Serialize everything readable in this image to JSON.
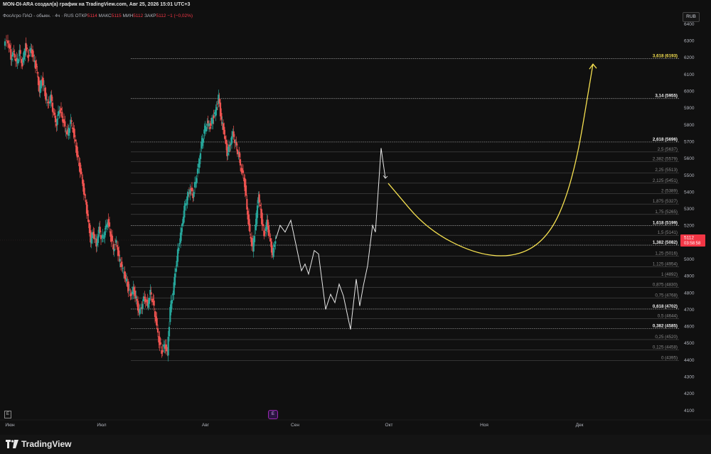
{
  "header": {
    "title": "MON-DI-ARA создал(а) график на TradingView.com, Авг 25, 2026 15:01 UTC+3"
  },
  "legend": {
    "symbol": "ФосАгро ПАО - обыкн. · 4ч · RUS",
    "open_label": "ОТКР",
    "open": "5114",
    "high_label": "МАКС",
    "high": "5115",
    "low_label": "МИН",
    "low": "5112",
    "close_label": "ЗАКР",
    "close": "5112",
    "change": "−1 (−0,02%)"
  },
  "currency": "RUB",
  "footer": {
    "brand": "TradingView",
    "e_icon": "E",
    "event_icon": "E"
  },
  "colors": {
    "background": "#101010",
    "up": "#26a69a",
    "down": "#ef5350",
    "projection": "#e8e8e8",
    "arrow": "#f5e050",
    "price_tag": "#f23645",
    "fib_line": "#8a8a8a"
  },
  "chart_data": {
    "type": "candlestick",
    "y_axis": {
      "ticks": [
        4100,
        4200,
        4300,
        4400,
        4500,
        4600,
        4700,
        4800,
        4900,
        5000,
        5100,
        5200,
        5300,
        5400,
        5500,
        5600,
        5700,
        5800,
        5900,
        6000,
        6100,
        6200,
        6300,
        6400
      ],
      "range": [
        4080,
        6440
      ],
      "position": "right"
    },
    "x_axis": {
      "labels": [
        "Июн",
        "Июл",
        "Авг",
        "Сен",
        "Окт",
        "Ноя",
        "Дек"
      ]
    },
    "price_marker": {
      "value": 5112,
      "label": "5112",
      "countdown": "03:58:58"
    },
    "fib_levels": [
      {
        "ratio": "3,618",
        "price": 6193,
        "label": "3,618 (6193)",
        "highlight": "yellow"
      },
      {
        "ratio": "3,14",
        "price": 5955,
        "label": "3,14 (5955)",
        "highlight": "bold"
      },
      {
        "ratio": "2,618",
        "price": 5696,
        "label": "2,618 (5696)",
        "highlight": "bold"
      },
      {
        "ratio": "2,5",
        "price": 5637,
        "label": "2,5 (5637)",
        "highlight": "none"
      },
      {
        "ratio": "2,382",
        "price": 5579,
        "label": "2,382 (5579)",
        "highlight": "none"
      },
      {
        "ratio": "2,25",
        "price": 5513,
        "label": "2,25 (5513)",
        "highlight": "none"
      },
      {
        "ratio": "2,125",
        "price": 5451,
        "label": "2,125 (5451)",
        "highlight": "none"
      },
      {
        "ratio": "2",
        "price": 5389,
        "label": "2 (5389)",
        "highlight": "none"
      },
      {
        "ratio": "1,875",
        "price": 5327,
        "label": "1,875 (5327)",
        "highlight": "none"
      },
      {
        "ratio": "1,75",
        "price": 5265,
        "label": "1,75 (5265)",
        "highlight": "none"
      },
      {
        "ratio": "1,618",
        "price": 5199,
        "label": "1,618 (5199)",
        "highlight": "bold"
      },
      {
        "ratio": "1,5",
        "price": 5141,
        "label": "1,5 (5141)",
        "highlight": "none"
      },
      {
        "ratio": "1,382",
        "price": 5082,
        "label": "1,382 (5082)",
        "highlight": "bold"
      },
      {
        "ratio": "1,25",
        "price": 5016,
        "label": "1,25 (5016)",
        "highlight": "none"
      },
      {
        "ratio": "1,125",
        "price": 4954,
        "label": "1,125 (4954)",
        "highlight": "none"
      },
      {
        "ratio": "1",
        "price": 4892,
        "label": "1 (4892)",
        "highlight": "none"
      },
      {
        "ratio": "0,875",
        "price": 4830,
        "label": "0,875 (4830)",
        "highlight": "none"
      },
      {
        "ratio": "0,75",
        "price": 4768,
        "label": "0,75 (4768)",
        "highlight": "none"
      },
      {
        "ratio": "0,618",
        "price": 4702,
        "label": "0,618 (4702)",
        "highlight": "bold"
      },
      {
        "ratio": "0,5",
        "price": 4644,
        "label": "0,5 (4644)",
        "highlight": "none"
      },
      {
        "ratio": "0,382",
        "price": 4585,
        "label": "0,382 (4585)",
        "highlight": "bold"
      },
      {
        "ratio": "0,25",
        "price": 4520,
        "label": "0,25 (4520)",
        "highlight": "none"
      },
      {
        "ratio": "0,125",
        "price": 4458,
        "label": "0,125 (4458)",
        "highlight": "none"
      },
      {
        "ratio": "0",
        "price": 4395,
        "label": "0 (4395)",
        "highlight": "none"
      }
    ],
    "price_path": [
      [
        0,
        6280
      ],
      [
        6,
        6300
      ],
      [
        10,
        6200
      ],
      [
        14,
        6230
      ],
      [
        18,
        6160
      ],
      [
        22,
        6230
      ],
      [
        26,
        6150
      ],
      [
        30,
        6270
      ],
      [
        34,
        6210
      ],
      [
        38,
        6250
      ],
      [
        42,
        6190
      ],
      [
        46,
        6130
      ],
      [
        50,
        6000
      ],
      [
        54,
        6080
      ],
      [
        58,
        5980
      ],
      [
        62,
        5920
      ],
      [
        66,
        5960
      ],
      [
        70,
        5860
      ],
      [
        74,
        5800
      ],
      [
        78,
        5900
      ],
      [
        82,
        5850
      ],
      [
        86,
        5780
      ],
      [
        90,
        5740
      ],
      [
        94,
        5820
      ],
      [
        98,
        5760
      ],
      [
        102,
        5650
      ],
      [
        106,
        5560
      ],
      [
        110,
        5470
      ],
      [
        114,
        5360
      ],
      [
        118,
        5250
      ],
      [
        122,
        5110
      ],
      [
        126,
        5160
      ],
      [
        130,
        5080
      ],
      [
        134,
        5180
      ],
      [
        138,
        5110
      ],
      [
        142,
        5160
      ],
      [
        146,
        5230
      ],
      [
        150,
        5150
      ],
      [
        154,
        5060
      ],
      [
        158,
        5100
      ],
      [
        162,
        5000
      ],
      [
        166,
        4950
      ],
      [
        170,
        4900
      ],
      [
        174,
        4850
      ],
      [
        178,
        4780
      ],
      [
        182,
        4820
      ],
      [
        186,
        4760
      ],
      [
        190,
        4680
      ],
      [
        194,
        4720
      ],
      [
        198,
        4780
      ],
      [
        202,
        4720
      ],
      [
        206,
        4800
      ],
      [
        210,
        4740
      ],
      [
        214,
        4630
      ],
      [
        218,
        4520
      ],
      [
        222,
        4450
      ],
      [
        226,
        4490
      ],
      [
        230,
        4440
      ],
      [
        234,
        4700
      ],
      [
        238,
        4800
      ],
      [
        242,
        4960
      ],
      [
        246,
        5080
      ],
      [
        250,
        5180
      ],
      [
        254,
        5300
      ],
      [
        258,
        5360
      ],
      [
        262,
        5420
      ],
      [
        266,
        5380
      ],
      [
        270,
        5470
      ],
      [
        274,
        5560
      ],
      [
        278,
        5680
      ],
      [
        282,
        5760
      ],
      [
        286,
        5810
      ],
      [
        290,
        5790
      ],
      [
        294,
        5840
      ],
      [
        298,
        5880
      ],
      [
        302,
        5960
      ],
      [
        306,
        5820
      ],
      [
        310,
        5750
      ],
      [
        314,
        5630
      ],
      [
        318,
        5680
      ],
      [
        322,
        5750
      ],
      [
        326,
        5680
      ],
      [
        330,
        5620
      ],
      [
        334,
        5530
      ],
      [
        338,
        5480
      ],
      [
        342,
        5300
      ],
      [
        346,
        5150
      ],
      [
        350,
        5060
      ],
      [
        354,
        5200
      ],
      [
        358,
        5380
      ],
      [
        362,
        5260
      ],
      [
        366,
        5140
      ],
      [
        370,
        5220
      ],
      [
        374,
        5120
      ],
      [
        378,
        5020
      ],
      [
        382,
        5120
      ]
    ],
    "projection_path": [
      [
        382,
        5120
      ],
      [
        388,
        5200
      ],
      [
        395,
        5160
      ],
      [
        403,
        5230
      ],
      [
        418,
        4930
      ],
      [
        423,
        4970
      ],
      [
        428,
        4910
      ],
      [
        436,
        5050
      ],
      [
        442,
        5030
      ],
      [
        452,
        4700
      ],
      [
        459,
        4790
      ],
      [
        465,
        4740
      ],
      [
        471,
        4850
      ],
      [
        477,
        4780
      ],
      [
        487,
        4580
      ],
      [
        495,
        4880
      ],
      [
        500,
        4720
      ],
      [
        505,
        4840
      ],
      [
        511,
        4960
      ],
      [
        518,
        5200
      ],
      [
        522,
        5160
      ],
      [
        530,
        5660
      ],
      [
        536,
        5480
      ]
    ],
    "arrow_path": [
      [
        540,
        5450
      ],
      [
        600,
        5150
      ],
      [
        690,
        4990
      ],
      [
        760,
        5080
      ],
      [
        800,
        5450
      ],
      [
        828,
        6160
      ]
    ]
  }
}
